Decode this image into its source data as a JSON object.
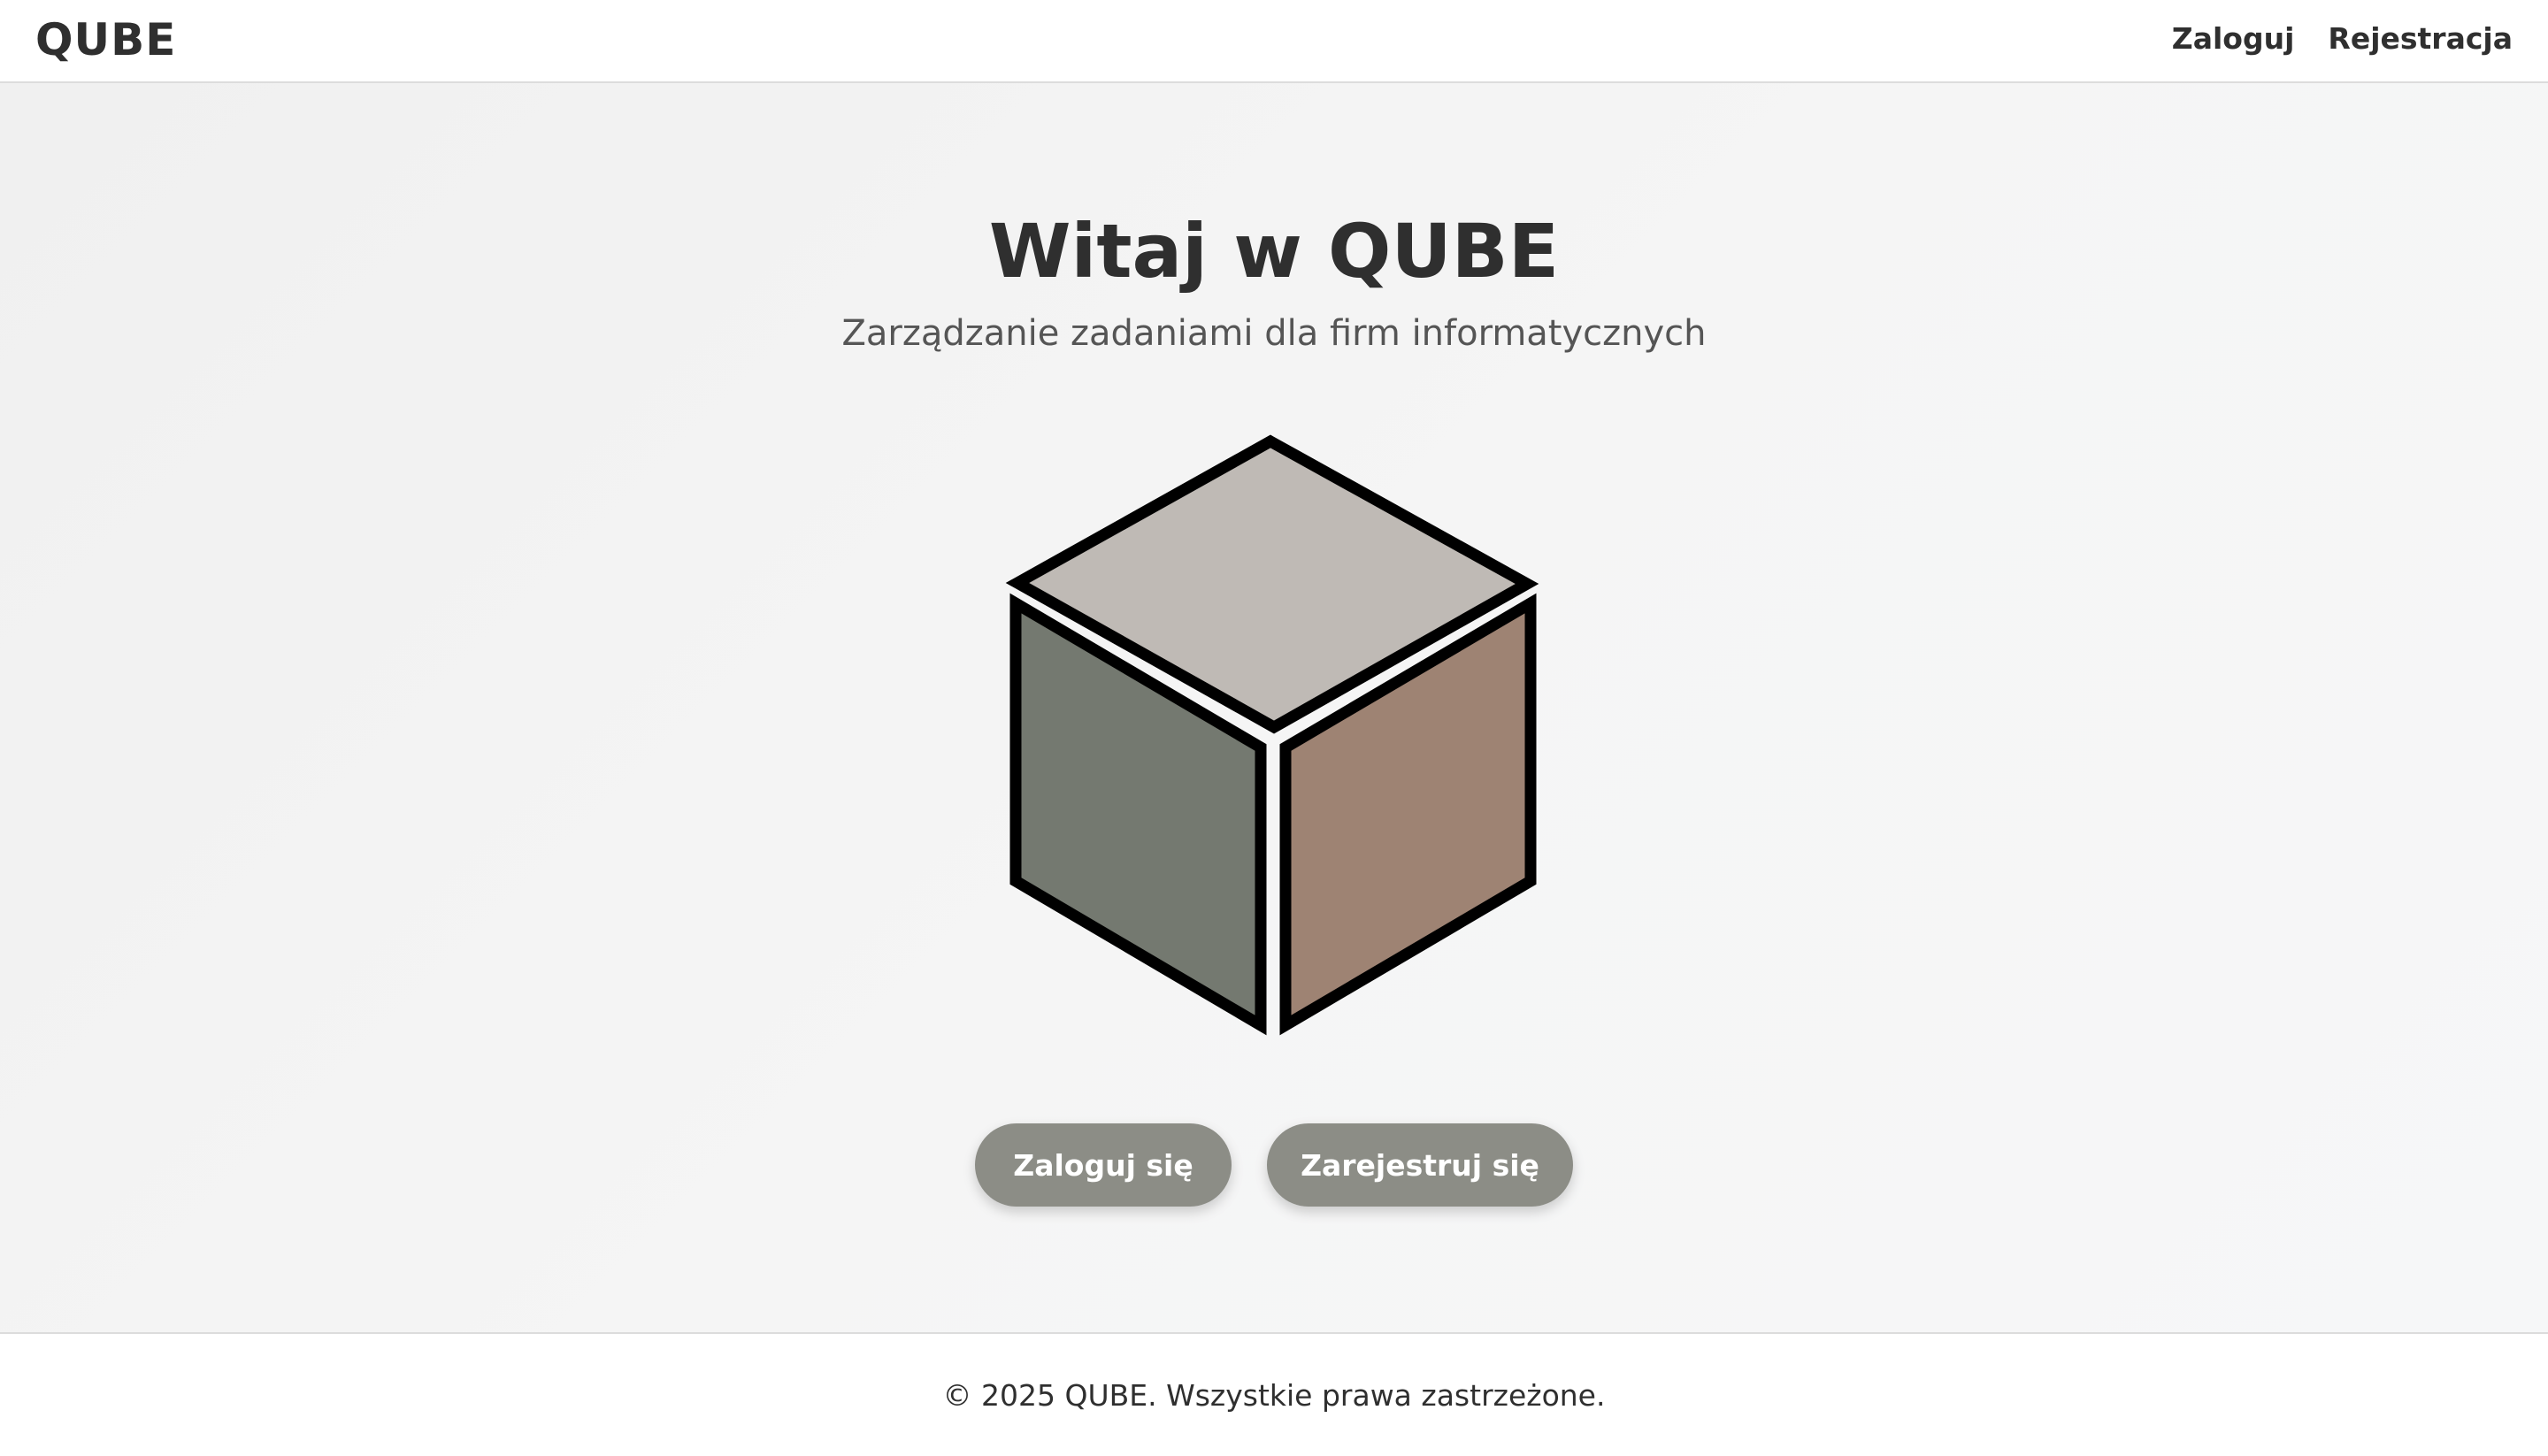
{
  "navbar": {
    "brand": "QUBE",
    "links": [
      {
        "label": "Zaloguj"
      },
      {
        "label": "Rejestracja"
      }
    ]
  },
  "hero": {
    "title": "Witaj w QUBE",
    "subtitle": "Zarządzanie zadaniami dla firm informatycznych",
    "logo_icon": "cube-icon",
    "logo_colors": {
      "top": "#bfbab5",
      "left": "#747970",
      "right": "#9e8373",
      "outline": "#000000"
    },
    "buttons": {
      "login_label": "Zaloguj się",
      "register_label": "Zarejestruj się",
      "color": "#8c8d86"
    }
  },
  "footer": {
    "text": "© 2025 QUBE. Wszystkie prawa zastrzeżone."
  }
}
